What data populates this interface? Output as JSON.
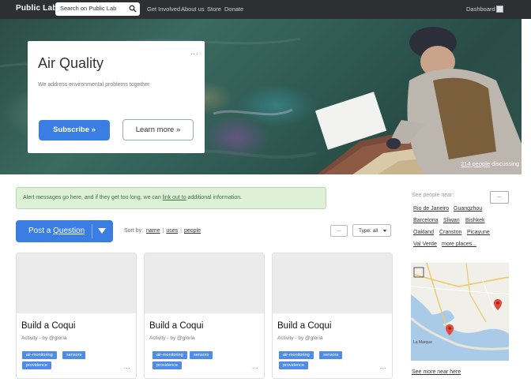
{
  "navbar": {
    "brand": "Public Lab",
    "search_placeholder": "Search on Public Lab",
    "links": [
      "Get Involved",
      "About us",
      "Store",
      "Donate"
    ],
    "dashboard": "Dashboard"
  },
  "hero": {
    "title": "Air Quality",
    "subtitle": "We address environmental problems together",
    "menu": "...",
    "subscribe": "Subscribe »",
    "learn_more": "Learn more »",
    "people_count": "214 people",
    "discussing": " discussing"
  },
  "alert": {
    "before": "Alert messages go here, and if they get too long, we can ",
    "link": "link out to",
    "after": " additional information."
  },
  "post": {
    "prefix": "Post a ",
    "link": "Question"
  },
  "sort": {
    "label": "Sort by:",
    "options": [
      "name",
      "uses",
      "people"
    ]
  },
  "filters": {
    "dots": "...",
    "type": "Type: all"
  },
  "cards": [
    {
      "title": "Build a Coqui",
      "meta": "Activity - by @gloria",
      "tags": [
        "air-monitoring",
        "sensors",
        "providence"
      ],
      "dots": "..."
    },
    {
      "title": "Build a Coqui",
      "meta": "Activity - by @gloria",
      "tags": [
        "air-monitoring",
        "sensors",
        "providence"
      ],
      "dots": "..."
    },
    {
      "title": "Build a Coqui",
      "meta": "Activity - by @gloria",
      "tags": [
        "air-monitoring",
        "sensors",
        "providence"
      ],
      "dots": "..."
    }
  ],
  "sidebar": {
    "near_label": "See people near:",
    "near_btn": "...",
    "cities": [
      "Rio de Janeiro",
      "Guangzhou",
      "Barcelona",
      "Sliwan",
      "Bishkek",
      "Oakland",
      "Cranston",
      "Picayune",
      "Val Verde",
      "more places..."
    ],
    "map_labels": [
      "La Marque"
    ],
    "see_more": "See more near here"
  },
  "colors": {
    "navbar": "#2d3033",
    "primary": "#3b7ee3",
    "tag": "#4f8ce8",
    "alert_bg": "#dff0d8",
    "alert_text": "#3c763d"
  }
}
